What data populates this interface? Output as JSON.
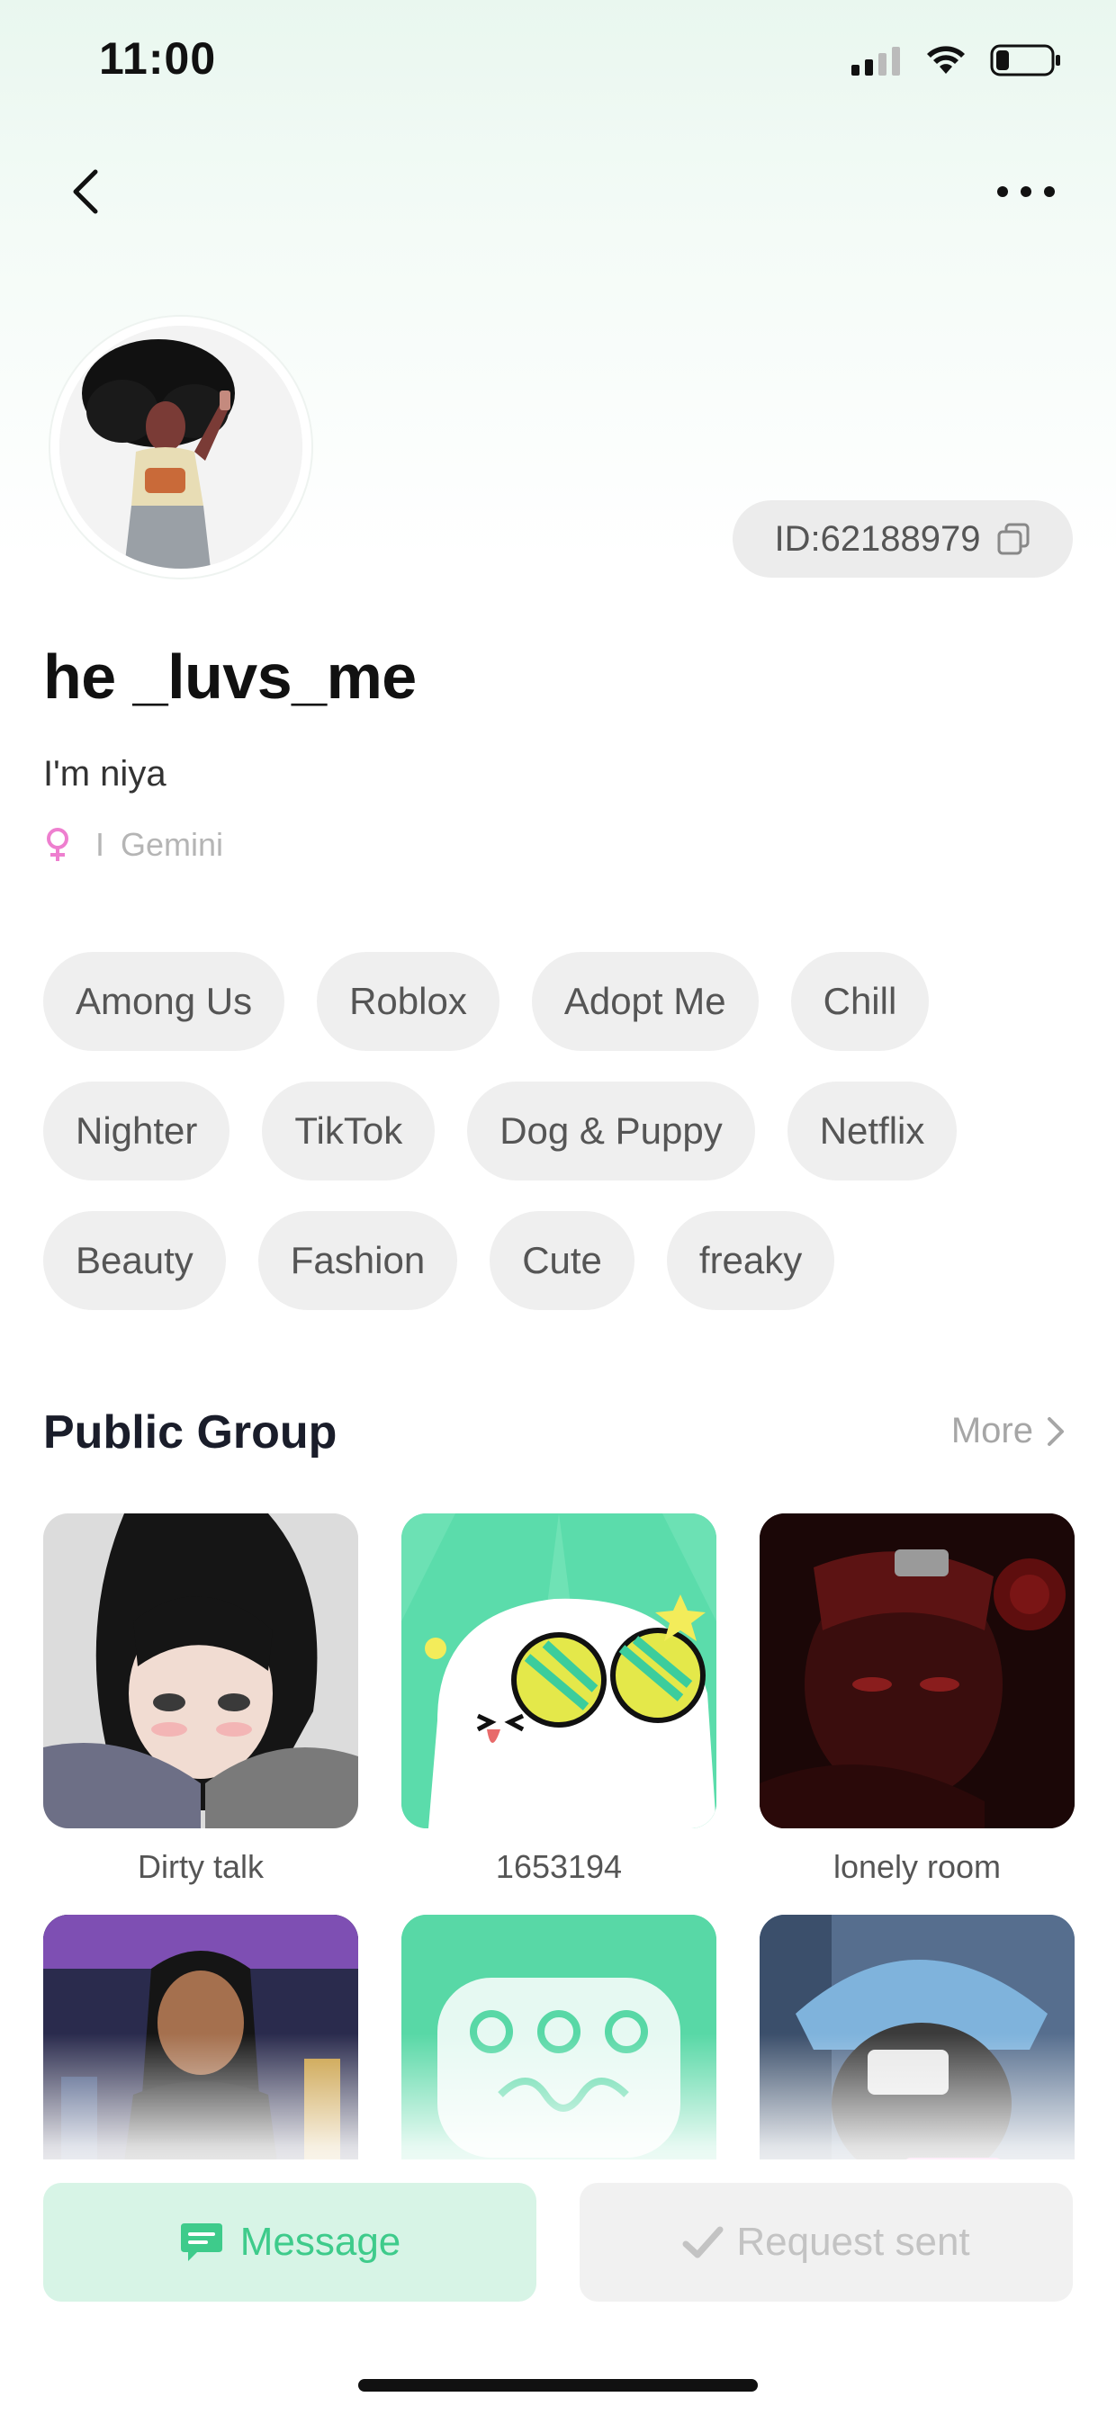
{
  "status_bar": {
    "time": "11:00"
  },
  "profile": {
    "id_label": "ID:62188979",
    "username": "he _luvs_me",
    "bio": "I'm niya",
    "zodiac_separator": "I",
    "zodiac": "Gemini",
    "gender_color": "#ee7fcf"
  },
  "tags": [
    [
      "Among Us",
      "Roblox",
      "Adopt Me",
      "Chill"
    ],
    [
      "Nighter",
      "TikTok",
      "Dog & Puppy",
      "Netflix"
    ],
    [
      "Beauty",
      "Fashion",
      "Cute",
      "freaky"
    ]
  ],
  "public_group": {
    "title": "Public Group",
    "more_label": "More",
    "groups": [
      {
        "name": "Dirty talk"
      },
      {
        "name": "1653194"
      },
      {
        "name": "lonely room"
      }
    ]
  },
  "actions": {
    "message_label": "Message",
    "request_label": "Request sent"
  },
  "colors": {
    "accent_green": "#3ecb8b",
    "message_bg": "#d7f4e6",
    "disabled_bg": "#f1f1f1"
  }
}
